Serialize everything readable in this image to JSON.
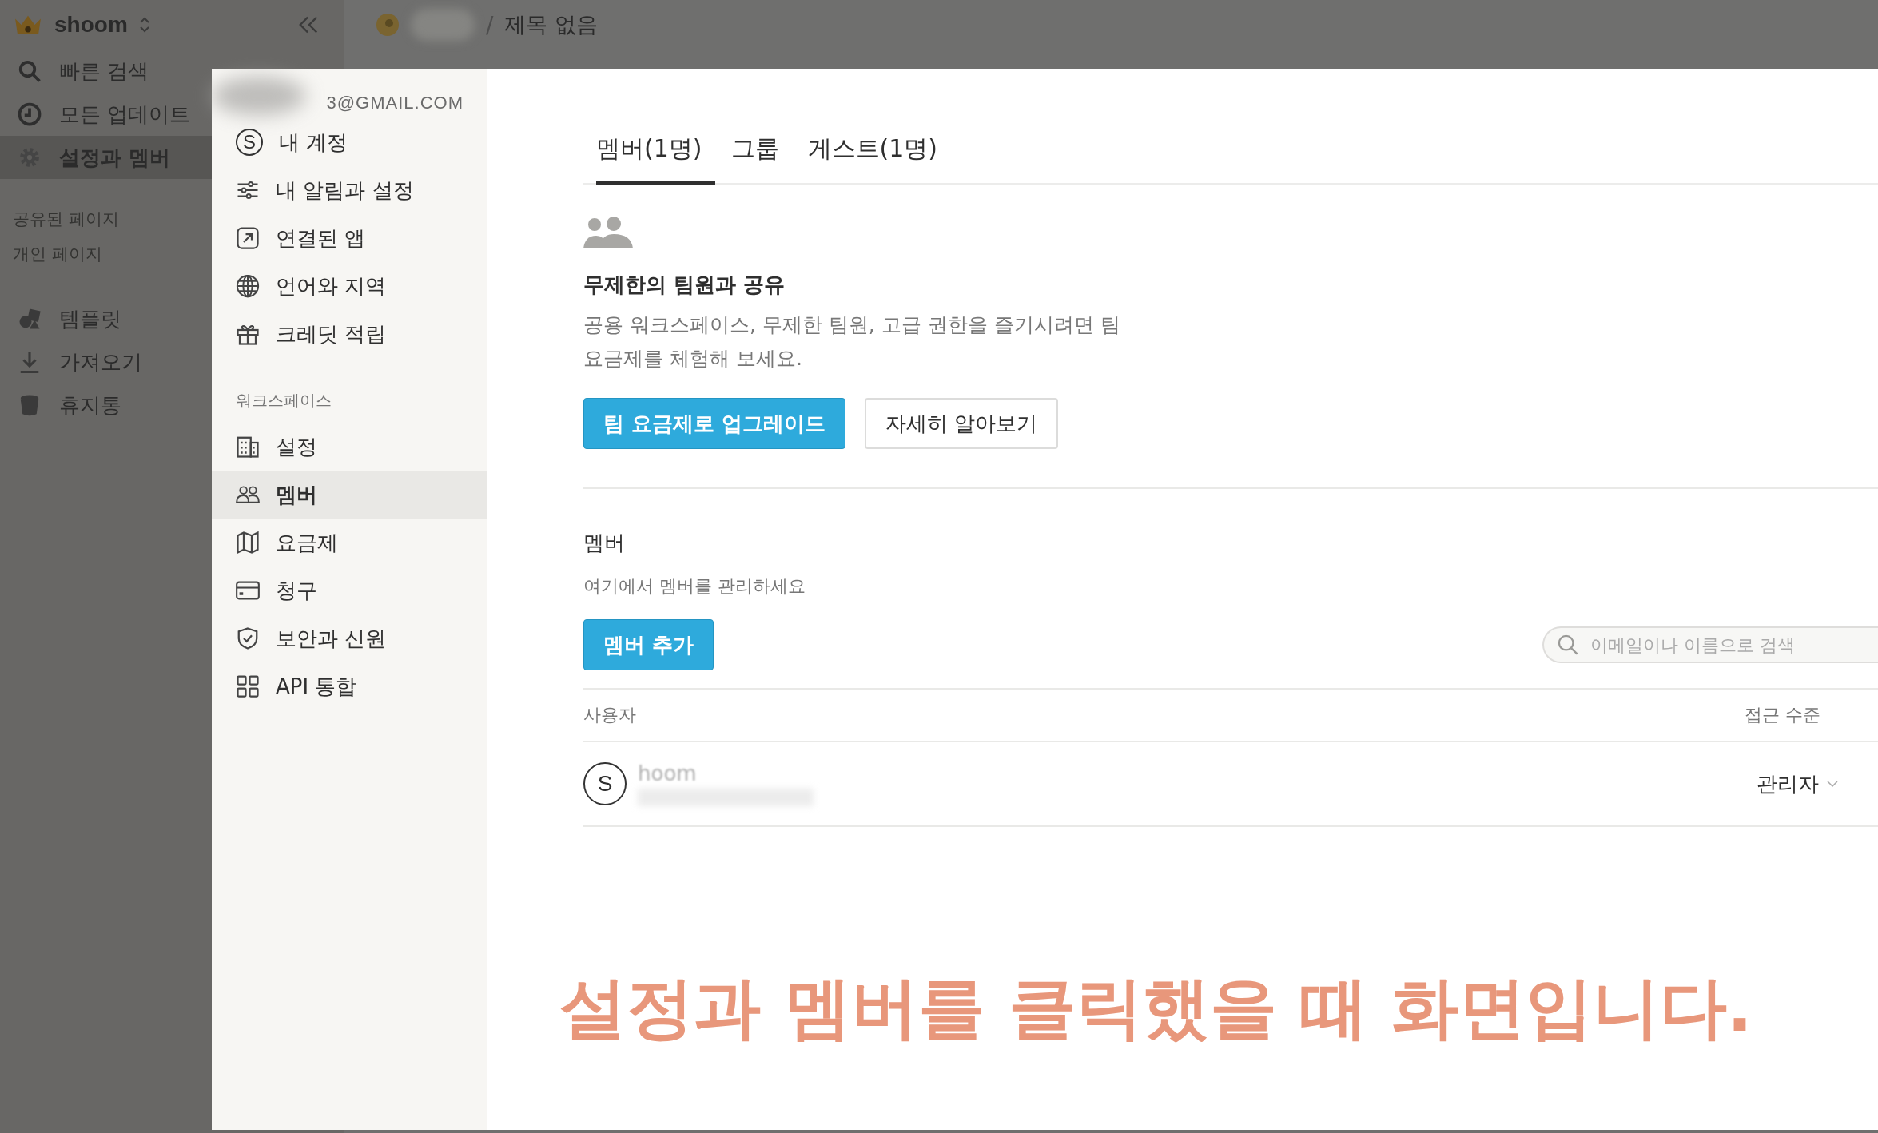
{
  "workspace": {
    "name": "shoom"
  },
  "breadcrumb": {
    "separator": "/",
    "page_title": "제목 없음"
  },
  "sidebar": {
    "items": [
      {
        "label": "빠른 검색",
        "selected": false
      },
      {
        "label": "모든 업데이트",
        "selected": false
      },
      {
        "label": "설정과 멤버",
        "selected": true
      }
    ],
    "sections": [
      "공유된 페이지",
      "개인 페이지"
    ],
    "bottom_items": [
      "템플릿",
      "가져오기",
      "휴지통"
    ]
  },
  "settings": {
    "account_email": "3@GMAIL.COM",
    "avatar_letter": "S",
    "account_items": [
      {
        "label": "내 계정",
        "selected": false
      },
      {
        "label": "내 알림과 설정",
        "selected": false
      },
      {
        "label": "연결된 앱",
        "selected": false
      },
      {
        "label": "언어와 지역",
        "selected": false
      },
      {
        "label": "크레딧 적립",
        "selected": false
      }
    ],
    "workspace_label": "워크스페이스",
    "workspace_items": [
      {
        "label": "설정",
        "selected": false
      },
      {
        "label": "멤버",
        "selected": true
      },
      {
        "label": "요금제",
        "selected": false
      },
      {
        "label": "청구",
        "selected": false
      },
      {
        "label": "보안과 신원",
        "selected": false
      },
      {
        "label": "API 통합",
        "selected": false
      }
    ]
  },
  "tabs": [
    {
      "label": "멤버(1명)",
      "selected": true
    },
    {
      "label": "그룹",
      "selected": false
    },
    {
      "label": "게스트(1명)",
      "selected": false
    }
  ],
  "upsell": {
    "heading": "무제한의 팀원과 공유",
    "description": "공용 워크스페이스, 무제한 팀원, 고급 권한을 즐기시려면 팀 요금제를 체험해 보세요.",
    "primary_button": "팀 요금제로 업그레이드",
    "secondary_button": "자세히 알아보기"
  },
  "members": {
    "title": "멤버",
    "subtitle": "여기에서 멤버를 관리하세요",
    "add_button": "멤버 추가",
    "search": {
      "placeholder": "이메일이나 이름으로 검색"
    },
    "columns": [
      "사용자",
      "접근 수준"
    ],
    "rows": [
      {
        "avatar_letter": "S",
        "name": "hoom",
        "role": "관리자"
      }
    ]
  },
  "caption": "설정과 멤버를 클릭했을 때 화면입니다."
}
